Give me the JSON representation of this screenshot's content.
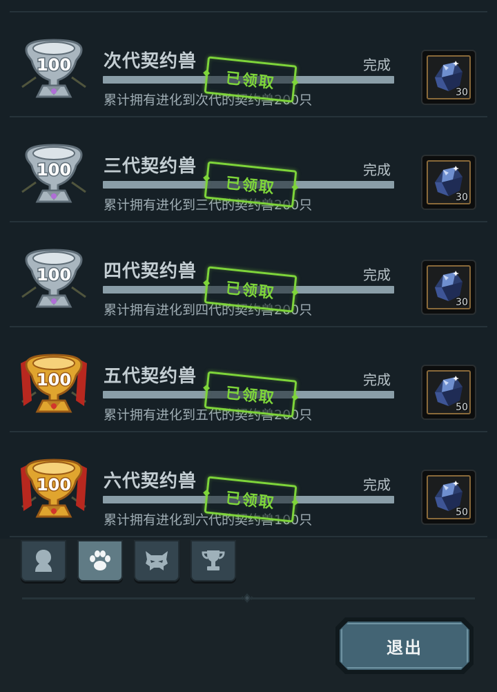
{
  "achievements": [
    {
      "title": "次代契约兽",
      "status": "完成",
      "stamp": "已领取",
      "description": "累计拥有进化到次代的契约兽200只",
      "trophy_label": "100",
      "trophy_tier": "silver",
      "reward_icon": "crystal-icon",
      "reward_count": "30"
    },
    {
      "title": "三代契约兽",
      "status": "完成",
      "stamp": "已领取",
      "description": "累计拥有进化到三代的契约兽200只",
      "trophy_label": "100",
      "trophy_tier": "silver",
      "reward_icon": "crystal-icon",
      "reward_count": "30"
    },
    {
      "title": "四代契约兽",
      "status": "完成",
      "stamp": "已领取",
      "description": "累计拥有进化到四代的契约兽200只",
      "trophy_label": "100",
      "trophy_tier": "silver",
      "reward_icon": "crystal-icon",
      "reward_count": "30"
    },
    {
      "title": "五代契约兽",
      "status": "完成",
      "stamp": "已领取",
      "description": "累计拥有进化到五代的契约兽200只",
      "trophy_label": "100",
      "trophy_tier": "gold",
      "reward_icon": "crystal-icon",
      "reward_count": "50"
    },
    {
      "title": "六代契约兽",
      "status": "完成",
      "stamp": "已领取",
      "description": "累计拥有进化到六代的契约兽100只",
      "trophy_label": "100",
      "trophy_tier": "gold",
      "reward_icon": "crystal-icon",
      "reward_count": "50"
    }
  ],
  "tabs": [
    {
      "icon": "character-silhouette-icon",
      "active": false
    },
    {
      "icon": "paw-icon",
      "active": true
    },
    {
      "icon": "monster-mask-icon",
      "active": false
    },
    {
      "icon": "trophy-icon",
      "active": false
    }
  ],
  "exit_label": "退出",
  "colors": {
    "stamp_green": "#7ed53a",
    "silver_trophy": "#aeb9c2",
    "gold_trophy": "#e0a52f",
    "exit_button": "#436474"
  }
}
